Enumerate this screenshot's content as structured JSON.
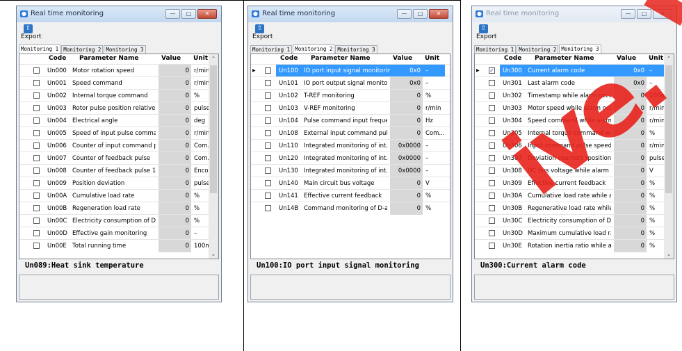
{
  "window_title": "Real time monitoring",
  "export_label": "Export",
  "tabs": [
    "Monitoring 1",
    "Monitoring 2",
    "Monitoring 3"
  ],
  "columns": {
    "code": "Code",
    "name": "Parameter Name",
    "value": "Value",
    "unit": "Unit"
  },
  "windows": [
    {
      "active_tab": 0,
      "description": "Un089:Heat sink temperature",
      "rows": [
        {
          "code": "Un000",
          "name": "Motor rotation speed",
          "value": "0",
          "unit": "r/min"
        },
        {
          "code": "Un001",
          "name": "Speed command",
          "value": "0",
          "unit": "r/min"
        },
        {
          "code": "Un002",
          "name": "Internal torque command",
          "value": "0",
          "unit": "%"
        },
        {
          "code": "Un003",
          "name": "Rotor pulse position relative t...",
          "value": "0",
          "unit": "pulse"
        },
        {
          "code": "Un004",
          "name": "Electrical angle",
          "value": "0",
          "unit": "deg"
        },
        {
          "code": "Un005",
          "name": "Speed of input pulse comma...",
          "value": "0",
          "unit": "r/min"
        },
        {
          "code": "Un006",
          "name": "Counter of input command p...",
          "value": "0",
          "unit": "Com..."
        },
        {
          "code": "Un007",
          "name": "Counter of feedback pulse",
          "value": "0",
          "unit": "Com..."
        },
        {
          "code": "Un008",
          "name": "Counter of feedback pulse 1",
          "value": "0",
          "unit": "Enco..."
        },
        {
          "code": "Un009",
          "name": "Position deviation",
          "value": "0",
          "unit": "pulse"
        },
        {
          "code": "Un00A",
          "name": "Cumulative load rate",
          "value": "0",
          "unit": "%"
        },
        {
          "code": "Un00B",
          "name": "Regeneration load rate",
          "value": "0",
          "unit": "%"
        },
        {
          "code": "Un00C",
          "name": "Electricity consumption of DB...",
          "value": "0",
          "unit": "%"
        },
        {
          "code": "Un00D",
          "name": "Effective gain monitoring",
          "value": "0",
          "unit": "–"
        },
        {
          "code": "Un00E",
          "name": "Total running time",
          "value": "0",
          "unit": "100ms"
        }
      ]
    },
    {
      "active_tab": 1,
      "description": "Un100:IO port input signal monitoring",
      "rows": [
        {
          "code": "Un100",
          "name": "IO port input signal monitoring",
          "value": "0x0",
          "unit": "–",
          "selected": true
        },
        {
          "code": "Un101",
          "name": "IO port output signal monito...",
          "value": "0x0",
          "unit": "–"
        },
        {
          "code": "Un102",
          "name": "T-REF monitoring",
          "value": "0",
          "unit": "%"
        },
        {
          "code": "Un103",
          "name": "V-REF monitoring",
          "value": "0",
          "unit": "r/min"
        },
        {
          "code": "Un104",
          "name": "Pulse command input freque...",
          "value": "0",
          "unit": "Hz"
        },
        {
          "code": "Un108",
          "name": "External input command puls...",
          "value": "0",
          "unit": "Com..."
        },
        {
          "code": "Un110",
          "name": "Integrated monitoring of int...",
          "value": "0x0000",
          "unit": "–"
        },
        {
          "code": "Un120",
          "name": "Integrated monitoring of int...",
          "value": "0x0000",
          "unit": "–"
        },
        {
          "code": "Un130",
          "name": "Integrated monitoring of int...",
          "value": "0x0000",
          "unit": "–"
        },
        {
          "code": "Un140",
          "name": "Main circuit bus voltage",
          "value": "0",
          "unit": "V"
        },
        {
          "code": "Un141",
          "name": "Effective current feedback",
          "value": "0",
          "unit": "%"
        },
        {
          "code": "Un14B",
          "name": "Command monitoring of D-ax...",
          "value": "0",
          "unit": "%"
        }
      ]
    },
    {
      "active_tab": 2,
      "description": "Un300:Current alarm code",
      "rows": [
        {
          "code": "Un300",
          "name": "Current alarm code",
          "value": "0x0",
          "unit": "–",
          "selected": true,
          "checked": true
        },
        {
          "code": "Un301",
          "name": "Last alarm code",
          "value": "0x0",
          "unit": "–"
        },
        {
          "code": "Un302",
          "name": "Timestamp while alarm occurs",
          "value": "0",
          "unit": "100ms"
        },
        {
          "code": "Un303",
          "name": "Motor speed while alarm occurs",
          "value": "0",
          "unit": "r/min"
        },
        {
          "code": "Un304",
          "name": "Speed command while alarm ...",
          "value": "0",
          "unit": "r/min"
        },
        {
          "code": "Un305",
          "name": "Internal torque command w...",
          "value": "0",
          "unit": "%"
        },
        {
          "code": "Un306",
          "name": "Input command pulse speed ...",
          "value": "0",
          "unit": "r/min"
        },
        {
          "code": "Un307",
          "name": "Deviation counters (position ...",
          "value": "0",
          "unit": "pulse"
        },
        {
          "code": "Un308",
          "name": "DC bus voltage while alarm o...",
          "value": "0",
          "unit": "V"
        },
        {
          "code": "Un309",
          "name": "Effective current feedback",
          "value": "0",
          "unit": "%"
        },
        {
          "code": "Un30A",
          "name": "Cumulative load rate while al...",
          "value": "0",
          "unit": "%"
        },
        {
          "code": "Un30B",
          "name": "Regenerative load rate while ...",
          "value": "0",
          "unit": "%"
        },
        {
          "code": "Un30C",
          "name": "Electricity consumption of DB...",
          "value": "0",
          "unit": "%"
        },
        {
          "code": "Un30D",
          "name": "Maximum cumulative load rat...",
          "value": "0",
          "unit": "%"
        },
        {
          "code": "Un30E",
          "name": "Rotation inertia ratio while al...",
          "value": "0",
          "unit": "%"
        }
      ]
    }
  ],
  "colors": {
    "selection": "#3399ff",
    "titlebar": "#c2d7ef",
    "close": "#c24a34",
    "watermark": "#e8231c"
  }
}
